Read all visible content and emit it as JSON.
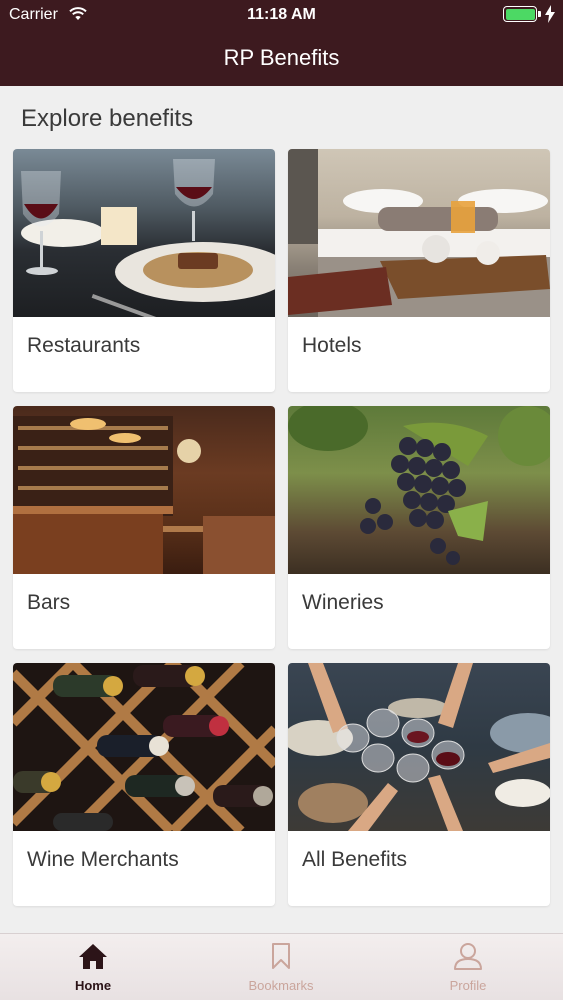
{
  "status": {
    "carrier": "Carrier",
    "time": "11:18 AM"
  },
  "nav": {
    "title": "RP Benefits"
  },
  "main": {
    "heading": "Explore benefits"
  },
  "cards": [
    {
      "label": "Restaurants"
    },
    {
      "label": "Hotels"
    },
    {
      "label": "Bars"
    },
    {
      "label": "Wineries"
    },
    {
      "label": "Wine Merchants"
    },
    {
      "label": "All Benefits"
    }
  ],
  "tabs": [
    {
      "label": "Home",
      "icon": "home-icon"
    },
    {
      "label": "Bookmarks",
      "icon": "bookmark-icon"
    },
    {
      "label": "Profile",
      "icon": "profile-icon"
    }
  ],
  "colors": {
    "brand": "#3d1a1f",
    "inactive_tab": "#caa59c",
    "battery": "#4cd964"
  }
}
